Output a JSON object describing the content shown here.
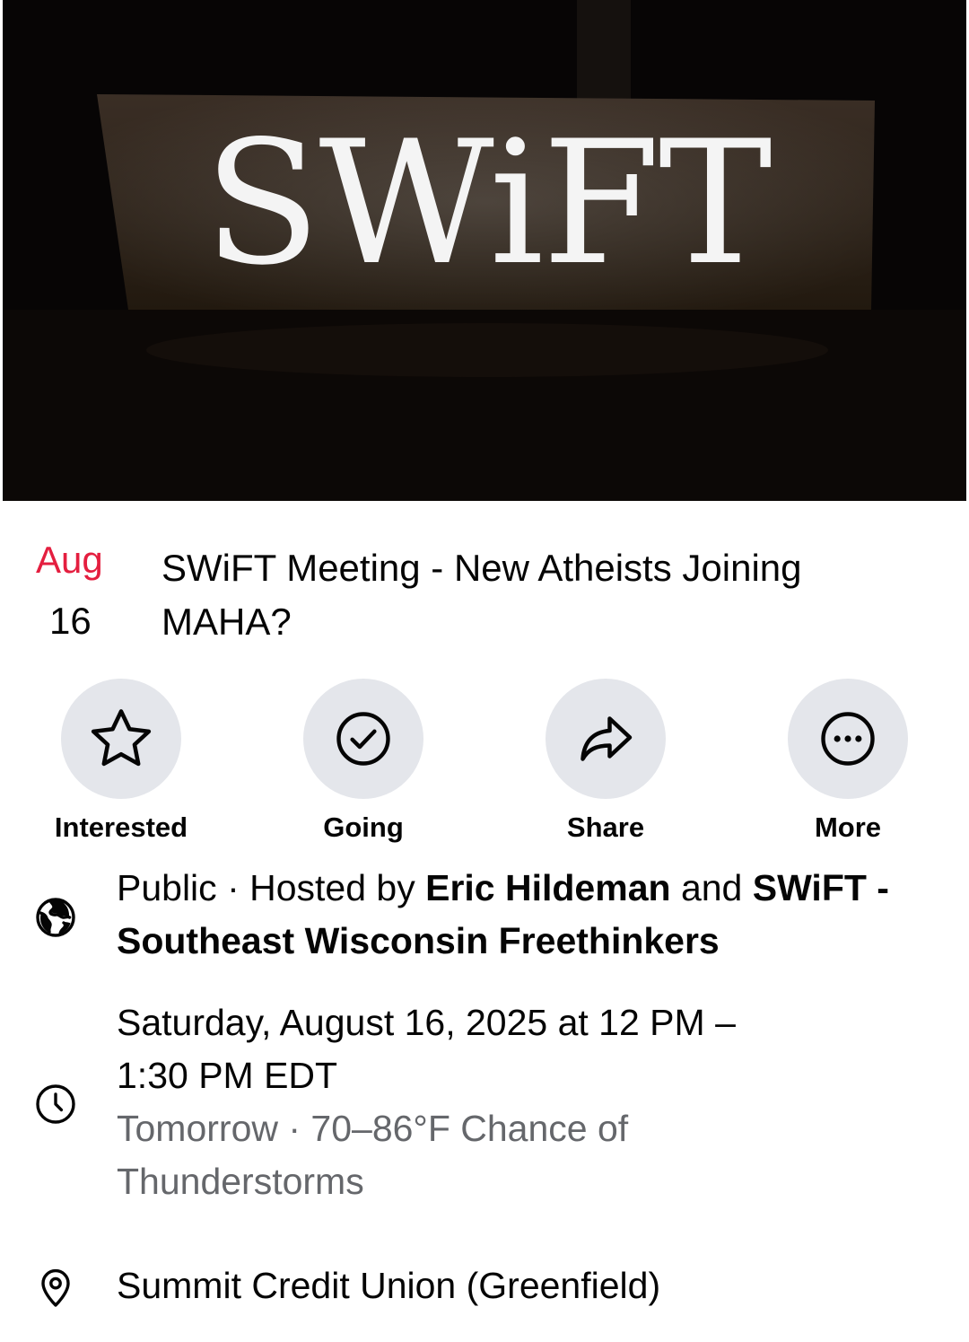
{
  "cover": {
    "sign_text": "SWiFT"
  },
  "event": {
    "month": "Aug",
    "day": "16",
    "title": "SWiFT Meeting - New Atheists Joining MAHA?"
  },
  "actions": [
    {
      "label": "Interested",
      "icon": "star-icon"
    },
    {
      "label": "Going",
      "icon": "check-circle-icon"
    },
    {
      "label": "Share",
      "icon": "share-arrow-icon"
    },
    {
      "label": "More",
      "icon": "more-dots-icon"
    }
  ],
  "host": {
    "privacy": "Public",
    "separator": " · ",
    "hosted_by": "Hosted by ",
    "host1": "Eric Hildeman",
    "and": " and ",
    "host2": "SWiFT - Southeast Wisconsin Freethinkers"
  },
  "time": {
    "datetime": "Saturday, August 16, 2025 at 12 PM – 1:30 PM EDT",
    "weather": "Tomorrow · 70–86°F Chance of Thunderstorms"
  },
  "location": {
    "name": "Summit Credit Union (Greenfield)"
  },
  "colors": {
    "date_month": "#e41e3f",
    "button_bg": "#e4e6eb",
    "secondary_text": "#65676b"
  }
}
